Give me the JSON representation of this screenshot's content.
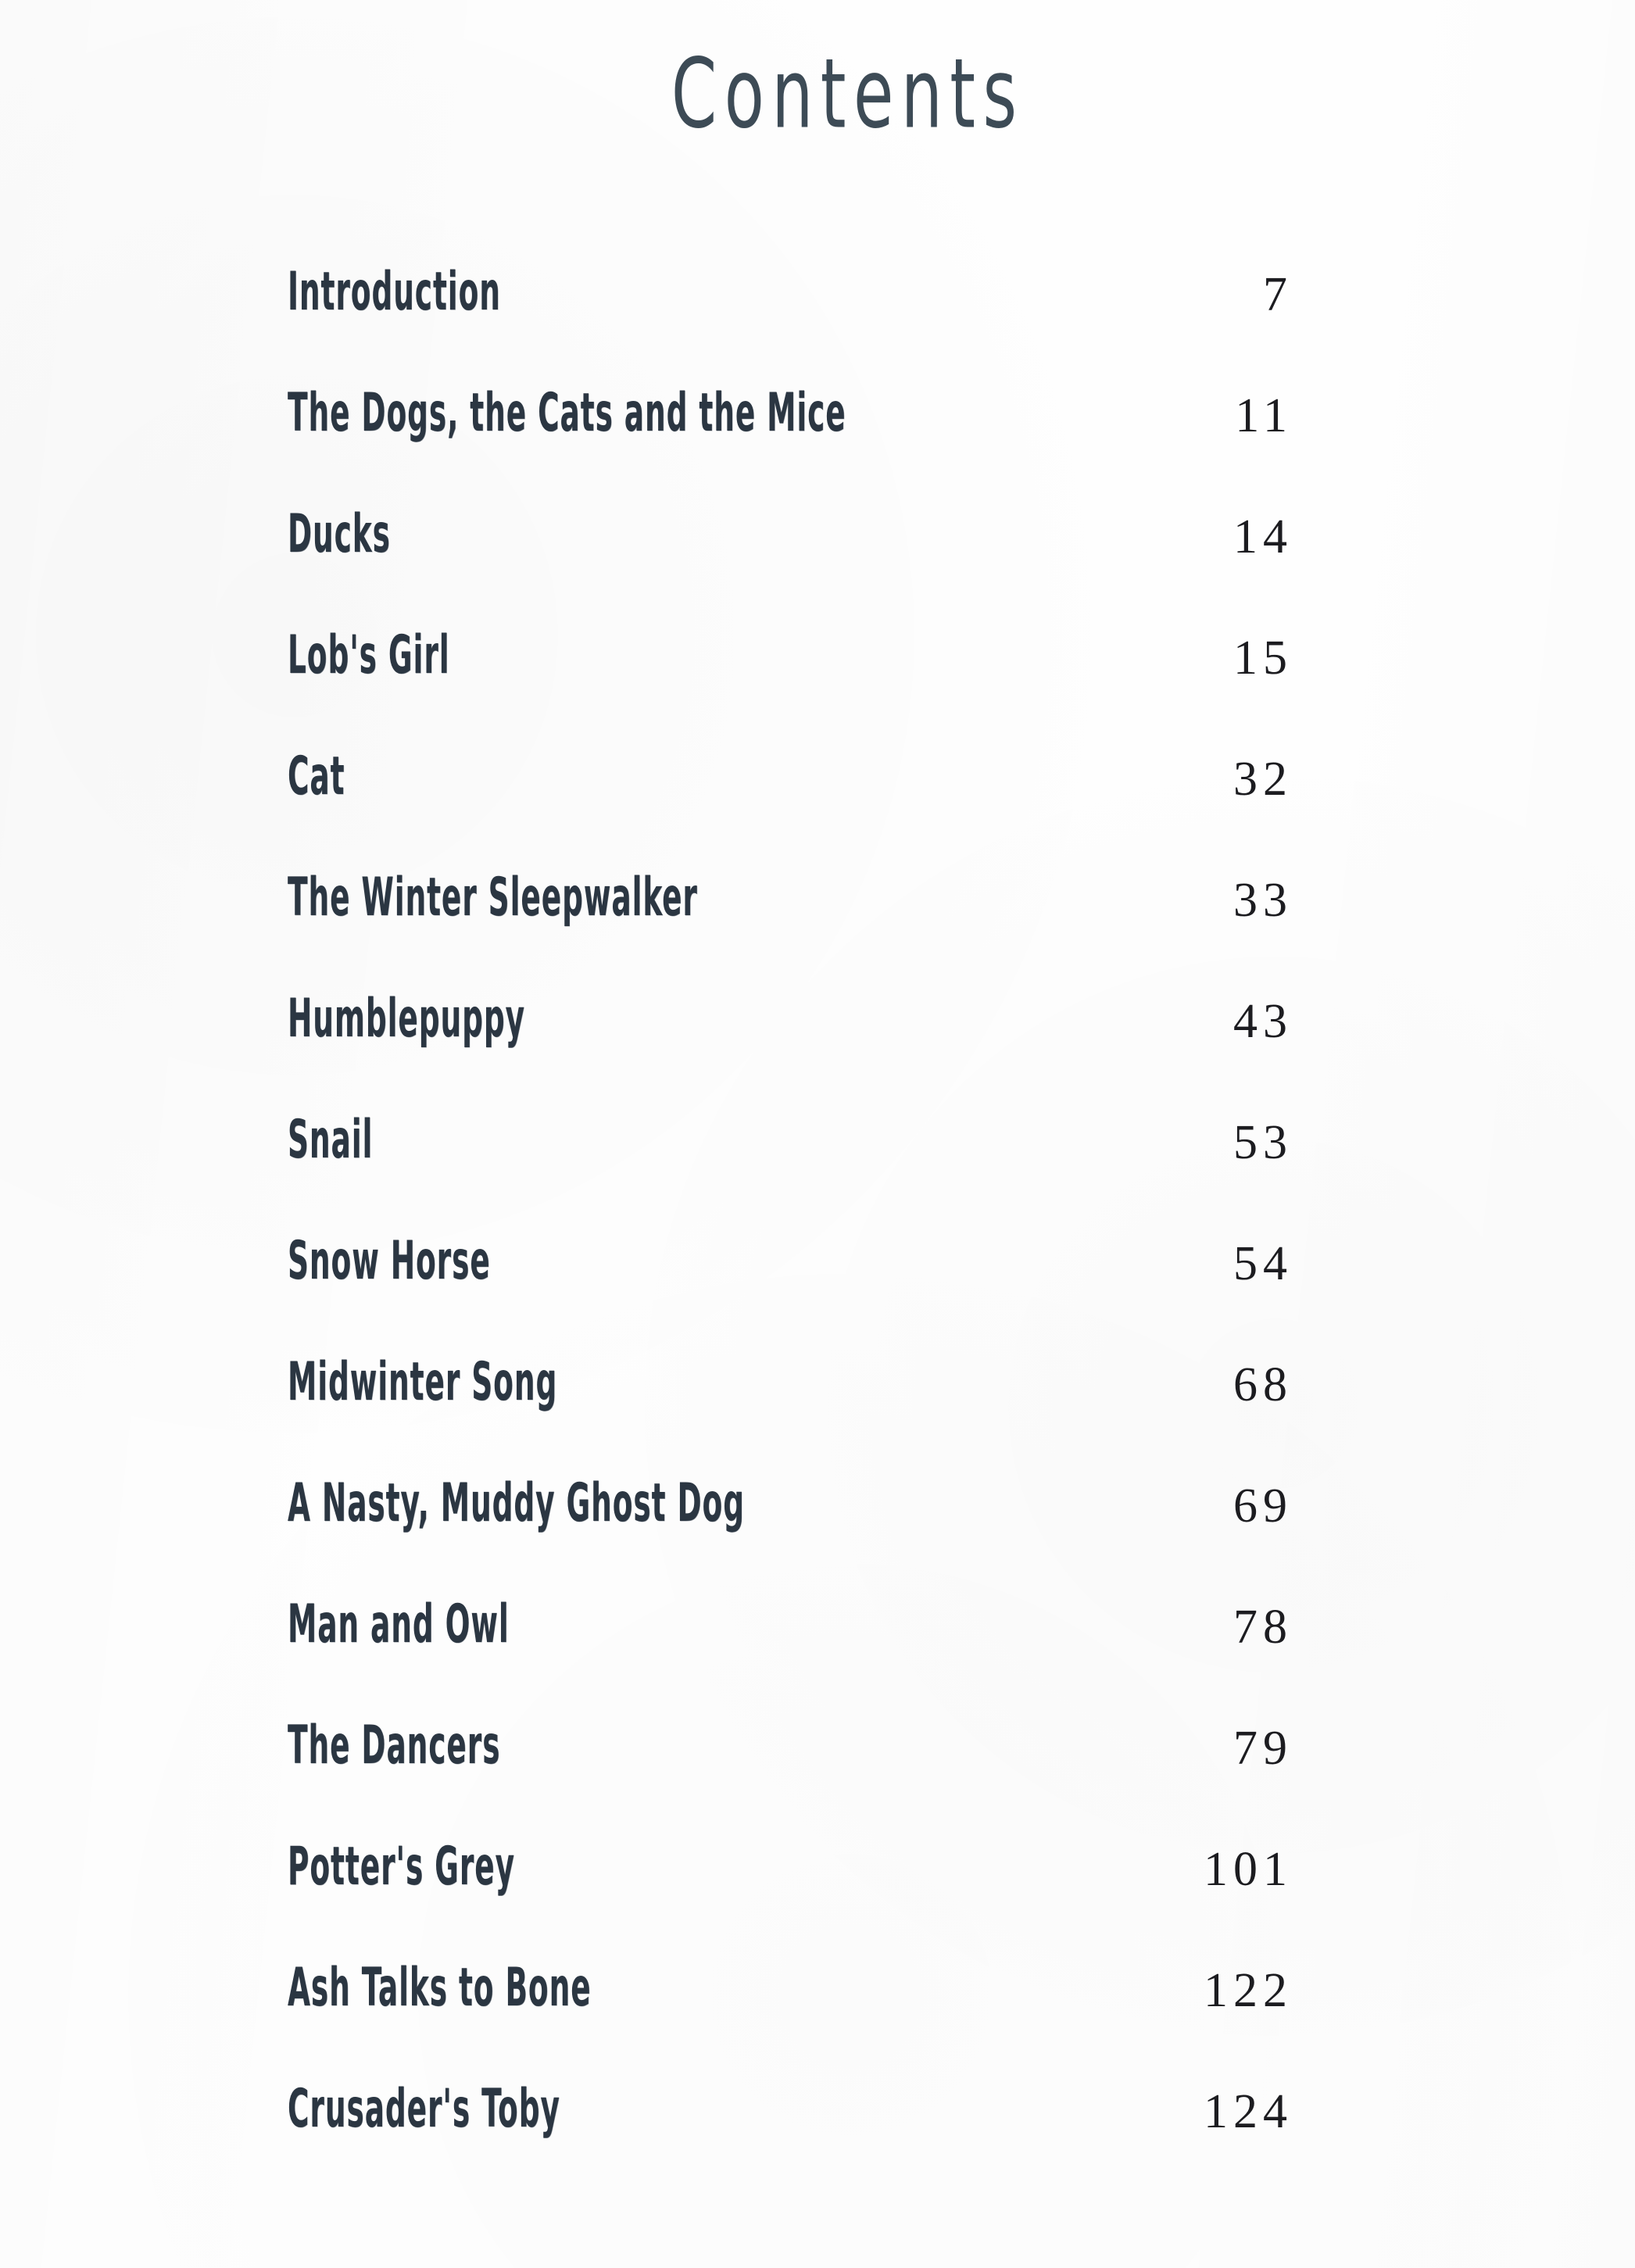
{
  "document": {
    "heading": "Contents",
    "text_color": "#2b3642",
    "title_color": "#3d4b56",
    "page_number_color": "#1c1c20",
    "background_color": "#ffffff"
  },
  "contents": {
    "entries": [
      {
        "title": "Introduction",
        "page": "7"
      },
      {
        "title": "The Dogs, the Cats and the Mice",
        "page": "11"
      },
      {
        "title": "Ducks",
        "page": "14"
      },
      {
        "title": "Lob's Girl",
        "page": "15"
      },
      {
        "title": "Cat",
        "page": "32"
      },
      {
        "title": "The Winter Sleepwalker",
        "page": "33"
      },
      {
        "title": "Humblepuppy",
        "page": "43"
      },
      {
        "title": "Snail",
        "page": "53"
      },
      {
        "title": "Snow Horse",
        "page": "54"
      },
      {
        "title": "Midwinter Song",
        "page": "68"
      },
      {
        "title": "A Nasty, Muddy Ghost Dog",
        "page": "69"
      },
      {
        "title": "Man and Owl",
        "page": "78"
      },
      {
        "title": "The Dancers",
        "page": "79"
      },
      {
        "title": "Potter's Grey",
        "page": "101"
      },
      {
        "title": "Ash Talks to Bone",
        "page": "122"
      },
      {
        "title": "Crusader's Toby",
        "page": "124"
      }
    ]
  }
}
